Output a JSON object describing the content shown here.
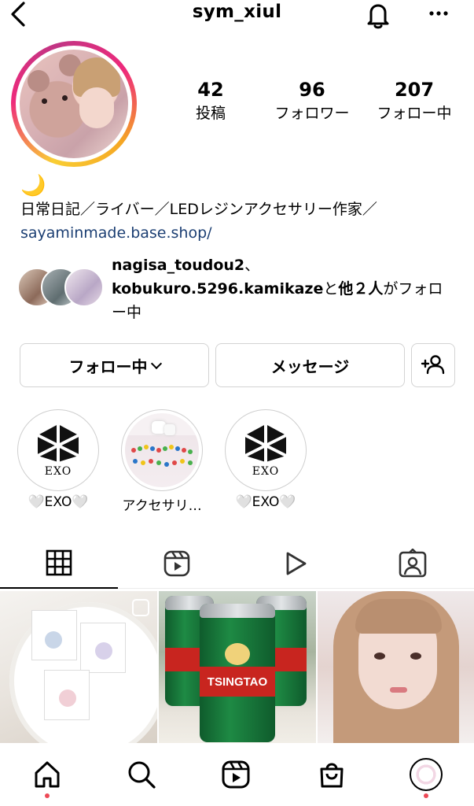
{
  "header": {
    "username": "sym_xiul",
    "back_icon": "chevron-left-icon",
    "bell_icon": "bell-icon",
    "more_icon": "more-horizontal-icon"
  },
  "profile": {
    "stats": [
      {
        "value": "42",
        "label": "投稿"
      },
      {
        "value": "96",
        "label": "フォロワー"
      },
      {
        "value": "207",
        "label": "フォロー中"
      }
    ],
    "bio_emoji": "🌙",
    "bio": "日常日記／ライバー／LEDレジンアクセサリー作家／",
    "link": "sayaminmade.base.shop/",
    "mutual": {
      "user1": "nagisa_toudou2",
      "sep": "、",
      "user2": "kobukuro.5296.kamikaze",
      "mid": "と",
      "others": "他２人",
      "tail": "がフォロー中"
    }
  },
  "actions": {
    "following_label": "フォロー中",
    "message_label": "メッセージ",
    "add_user_icon": "add-person-icon"
  },
  "highlights": [
    {
      "label": "🤍EXO🤍",
      "logo_text": "EXO"
    },
    {
      "label": "アクセサリ…"
    },
    {
      "label": "🤍EXO🤍",
      "logo_text": "EXO"
    }
  ],
  "tabs": [
    {
      "name": "grid",
      "icon": "grid-icon",
      "active": true
    },
    {
      "name": "reels",
      "icon": "reels-icon"
    },
    {
      "name": "video",
      "icon": "play-icon"
    },
    {
      "name": "tagged",
      "icon": "tagged-icon"
    }
  ],
  "posts": [
    {
      "alt": "flower resin earrings",
      "multi": true
    },
    {
      "alt": "tsingtao beer cans",
      "can_text": "TSINGTAO"
    },
    {
      "alt": "selfie"
    }
  ],
  "bottom_nav": [
    {
      "name": "home",
      "icon": "home-icon",
      "dot": true
    },
    {
      "name": "search",
      "icon": "search-icon"
    },
    {
      "name": "reels",
      "icon": "reels-icon"
    },
    {
      "name": "shop",
      "icon": "shop-icon"
    },
    {
      "name": "profile",
      "icon": "profile-avatar-icon",
      "dot": true
    }
  ],
  "colors": {
    "link": "#1c3f73",
    "notification_dot": "#ed4956",
    "ring_start": "#f9ce34",
    "ring_mid": "#ee2a7b"
  }
}
